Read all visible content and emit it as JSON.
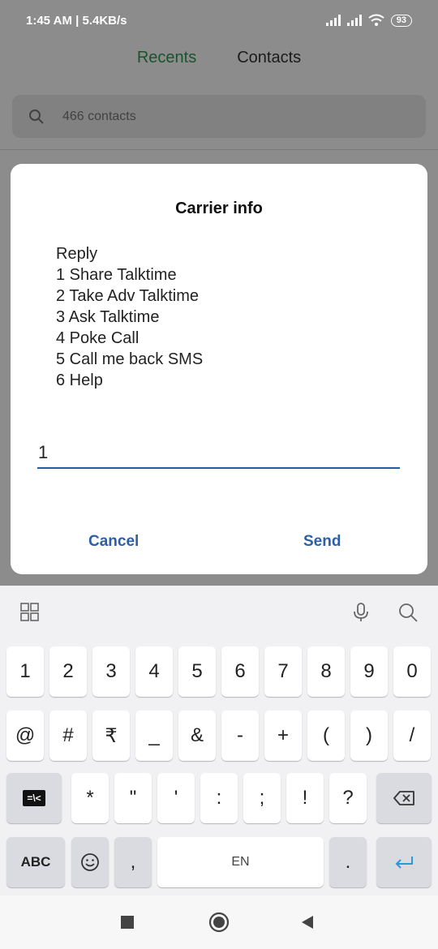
{
  "status_bar": {
    "time_speed": "1:45 AM | 5.4KB/s",
    "battery": "93"
  },
  "background": {
    "tabs": [
      {
        "label": "Recents",
        "active": true
      },
      {
        "label": "Contacts",
        "active": false
      }
    ],
    "search_placeholder": "466 contacts",
    "active_color": "#2e9a50"
  },
  "dialog": {
    "title": "Carrier info",
    "message_lines": [
      "Reply",
      "1 Share Talktime",
      "2 Take Adv Talktime",
      "3 Ask Talktime",
      "4 Poke Call",
      "5 Call me back SMS",
      "6 Help"
    ],
    "input_value": "1",
    "cancel_label": "Cancel",
    "send_label": "Send",
    "accent_color": "#2c5fa8"
  },
  "keyboard": {
    "toolbar_icons": [
      "grid-icon",
      "mic-icon",
      "search-icon"
    ],
    "row1": [
      "1",
      "2",
      "3",
      "4",
      "5",
      "6",
      "7",
      "8",
      "9",
      "0"
    ],
    "row2": [
      "@",
      "#",
      "₹",
      "_",
      "&",
      "-",
      "+",
      "(",
      ")",
      "/"
    ],
    "row3": [
      "*",
      "\"",
      "'",
      ":",
      ";",
      "!",
      "?"
    ],
    "row3_left_label": "=\\<",
    "abc_label": "ABC",
    "comma_label": ",",
    "space_label": "EN",
    "period_label": "."
  },
  "navbar": {
    "icons": [
      "recents-square-icon",
      "home-circle-icon",
      "back-triangle-icon"
    ]
  }
}
